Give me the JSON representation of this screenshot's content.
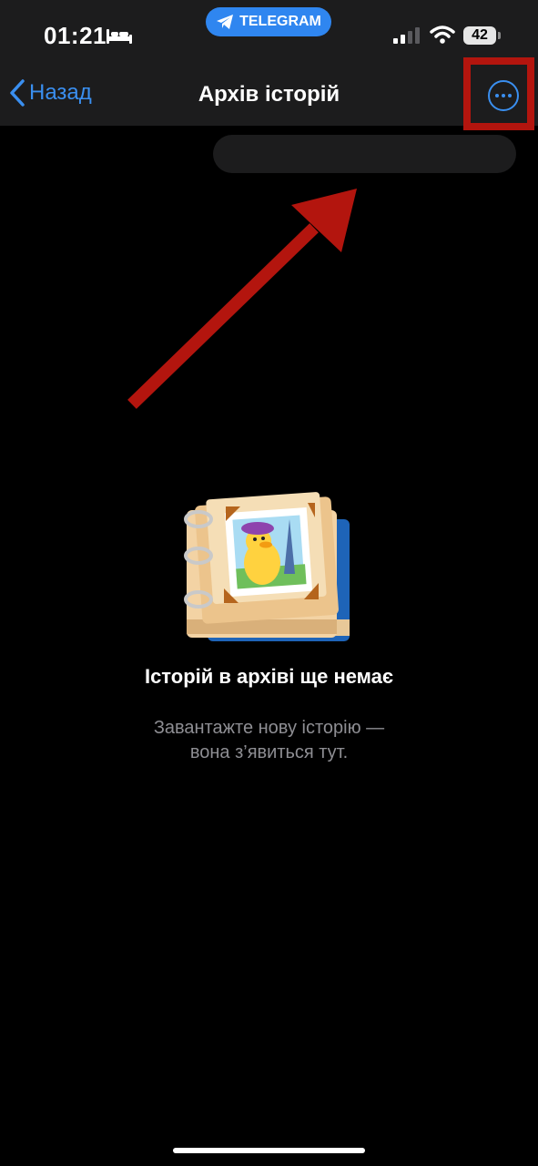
{
  "status_bar": {
    "time": "01:21",
    "pill_label": "TELEGRAM",
    "battery_level": "42"
  },
  "nav": {
    "back_label": "Назад",
    "title": "Архів історій"
  },
  "empty_state": {
    "title": "Історій в архіві ще немає",
    "subtitle_line1": "Завантажте нову історію —",
    "subtitle_line2": "вона з’явиться тут."
  },
  "colors": {
    "accent": "#3a8ff0",
    "annotation": "#b3150e",
    "bar_background": "#1c1c1d",
    "background": "#000000"
  },
  "icons": [
    "bed-icon",
    "telegram-icon",
    "signal-icon",
    "wifi-icon",
    "chevron-left-icon",
    "more-icon",
    "archive-album-sticker"
  ]
}
